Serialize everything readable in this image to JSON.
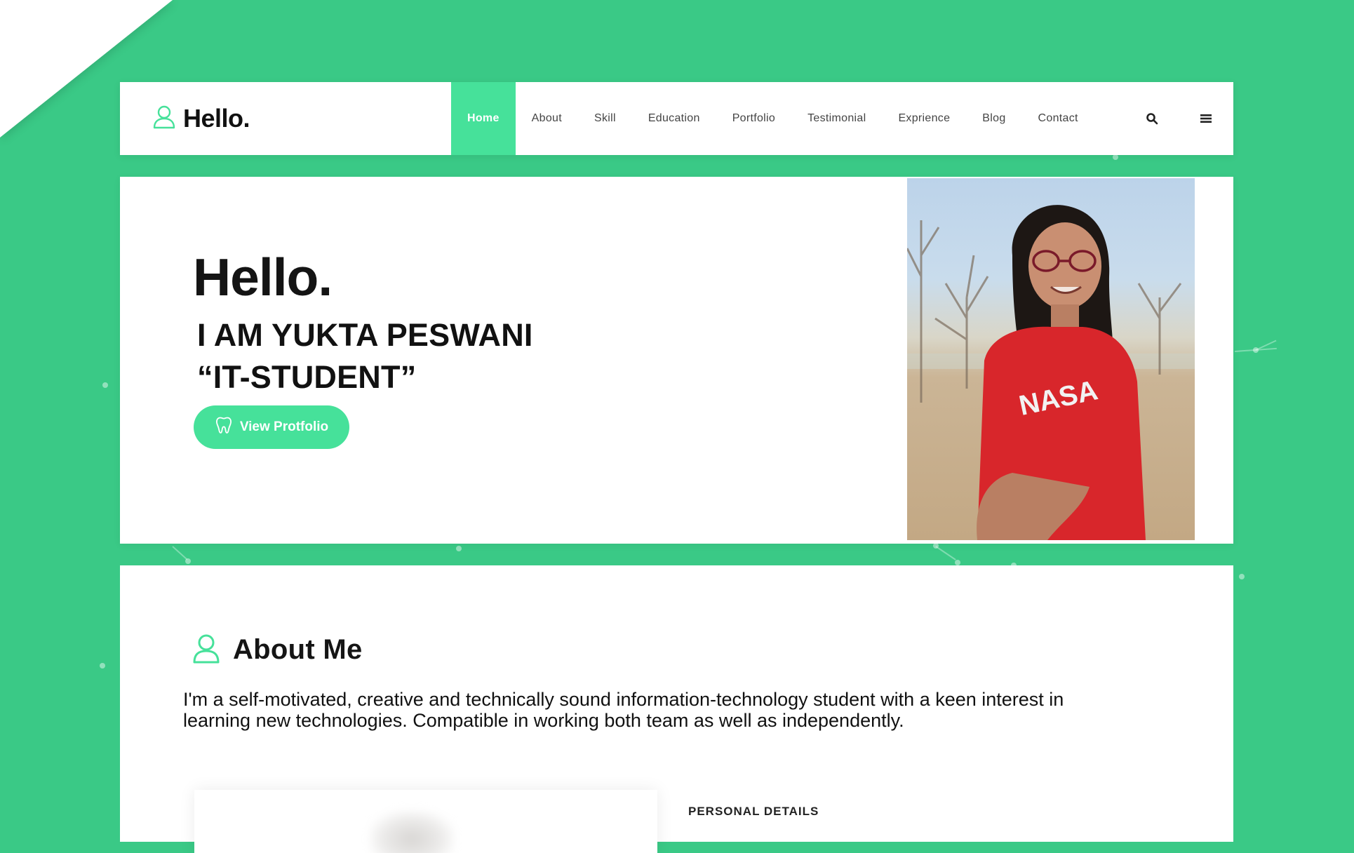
{
  "header": {
    "brand": "Hello.",
    "nav": [
      {
        "label": "Home",
        "active": true
      },
      {
        "label": "About"
      },
      {
        "label": "Skill"
      },
      {
        "label": "Education"
      },
      {
        "label": "Portfolio"
      },
      {
        "label": "Testimonial"
      },
      {
        "label": "Exprience"
      },
      {
        "label": "Blog"
      },
      {
        "label": "Contact"
      }
    ],
    "icons": [
      "search-icon",
      "menu-icon"
    ]
  },
  "hero": {
    "greeting": "Hello.",
    "name_line": "I AM YUKTA PESWANI",
    "role_line": "“IT-STUDENT”",
    "button_label": "View Protfolio",
    "button_icon": "tooth-icon"
  },
  "about": {
    "title": "About Me",
    "title_icon": "user-icon",
    "text": " I'm a self-motivated, creative and technically sound information-technology student with a keen interest in learning new technologies. Compatible in working both team as well as independently.",
    "personal_details_title": "PERSONAL DETAILS"
  },
  "colors": {
    "background": "#3ac986",
    "accent": "#46e19a",
    "text": "#111111"
  }
}
